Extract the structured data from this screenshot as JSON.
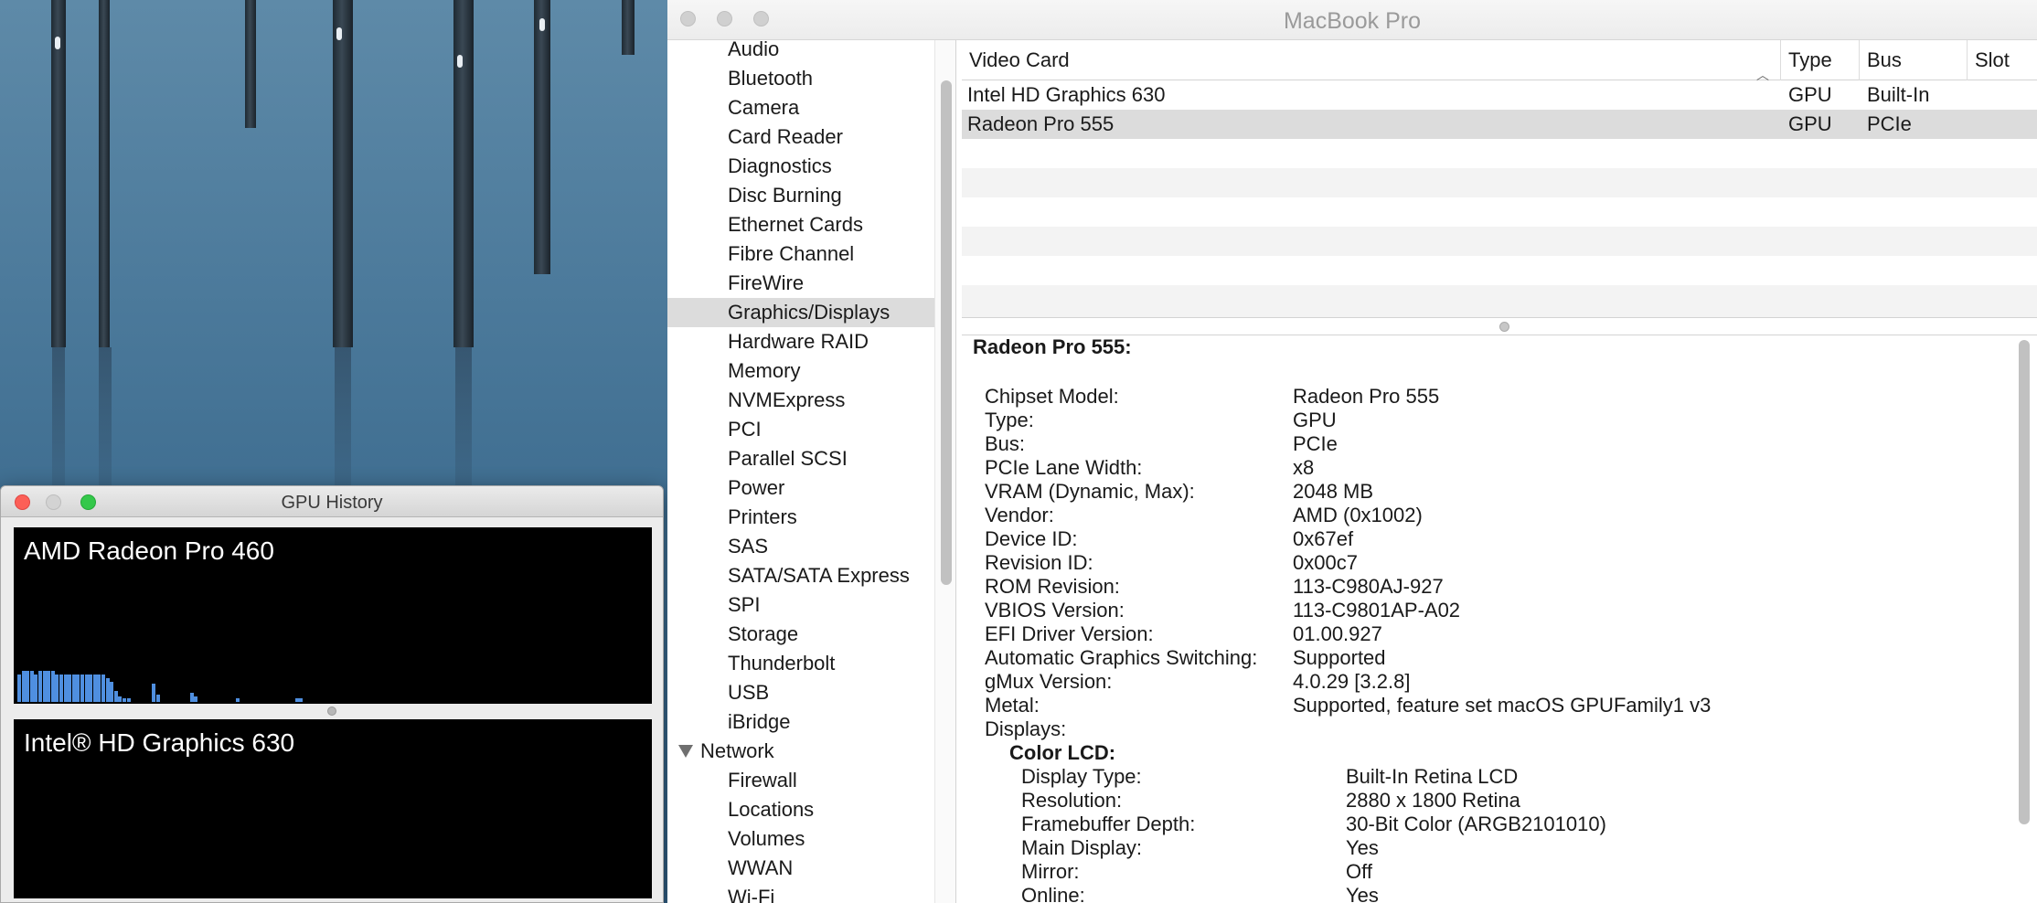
{
  "gpu_history": {
    "title": "GPU History",
    "panels": [
      {
        "name": "AMD Radeon Pro 460"
      },
      {
        "name": "Intel® HD Graphics 630"
      }
    ]
  },
  "window": {
    "title": "MacBook Pro"
  },
  "sidebar": {
    "items": [
      {
        "label": "Audio"
      },
      {
        "label": "Bluetooth"
      },
      {
        "label": "Camera"
      },
      {
        "label": "Card Reader"
      },
      {
        "label": "Diagnostics"
      },
      {
        "label": "Disc Burning"
      },
      {
        "label": "Ethernet Cards"
      },
      {
        "label": "Fibre Channel"
      },
      {
        "label": "FireWire"
      },
      {
        "label": "Graphics/Displays",
        "selected": true
      },
      {
        "label": "Hardware RAID"
      },
      {
        "label": "Memory"
      },
      {
        "label": "NVMExpress"
      },
      {
        "label": "PCI"
      },
      {
        "label": "Parallel SCSI"
      },
      {
        "label": "Power"
      },
      {
        "label": "Printers"
      },
      {
        "label": "SAS"
      },
      {
        "label": "SATA/SATA Express"
      },
      {
        "label": "SPI"
      },
      {
        "label": "Storage"
      },
      {
        "label": "Thunderbolt"
      },
      {
        "label": "USB"
      },
      {
        "label": "iBridge"
      },
      {
        "label": "Network",
        "section": true
      },
      {
        "label": "Firewall"
      },
      {
        "label": "Locations"
      },
      {
        "label": "Volumes"
      },
      {
        "label": "WWAN"
      },
      {
        "label": "Wi-Fi"
      }
    ]
  },
  "table": {
    "columns": [
      "Video Card",
      "Type",
      "Bus",
      "Slot"
    ],
    "rows": [
      {
        "card": "Intel HD Graphics 630",
        "type": "GPU",
        "bus": "Built-In",
        "slot": ""
      },
      {
        "card": "Radeon Pro 555",
        "type": "GPU",
        "bus": "PCIe",
        "slot": ""
      }
    ]
  },
  "detail": {
    "heading": "Radeon Pro 555:",
    "fields": [
      {
        "k": "Chipset Model:",
        "v": "Radeon Pro 555"
      },
      {
        "k": "Type:",
        "v": "GPU"
      },
      {
        "k": "Bus:",
        "v": "PCIe"
      },
      {
        "k": "PCIe Lane Width:",
        "v": "x8"
      },
      {
        "k": "VRAM (Dynamic, Max):",
        "v": "2048 MB"
      },
      {
        "k": "Vendor:",
        "v": "AMD (0x1002)"
      },
      {
        "k": "Device ID:",
        "v": "0x67ef"
      },
      {
        "k": "Revision ID:",
        "v": "0x00c7"
      },
      {
        "k": "ROM Revision:",
        "v": "113-C980AJ-927"
      },
      {
        "k": "VBIOS Version:",
        "v": "113-C9801AP-A02"
      },
      {
        "k": "EFI Driver Version:",
        "v": "01.00.927"
      },
      {
        "k": "Automatic Graphics Switching:",
        "v": "Supported"
      },
      {
        "k": "gMux Version:",
        "v": "4.0.29 [3.2.8]"
      },
      {
        "k": "Metal:",
        "v": "Supported, feature set macOS GPUFamily1 v3"
      },
      {
        "k": "Displays:",
        "v": ""
      }
    ],
    "display_name": "Color LCD:",
    "display_fields": [
      {
        "k": "Display Type:",
        "v": "Built-In Retina LCD"
      },
      {
        "k": "Resolution:",
        "v": "2880 x 1800 Retina"
      },
      {
        "k": "Framebuffer Depth:",
        "v": "30-Bit Color (ARGB2101010)"
      },
      {
        "k": "Main Display:",
        "v": "Yes"
      },
      {
        "k": "Mirror:",
        "v": "Off"
      },
      {
        "k": "Online:",
        "v": "Yes"
      }
    ]
  },
  "colors": {
    "accent_bar": "#4f8fe0",
    "close": "#fc5f57",
    "zoom": "#34c84a"
  }
}
